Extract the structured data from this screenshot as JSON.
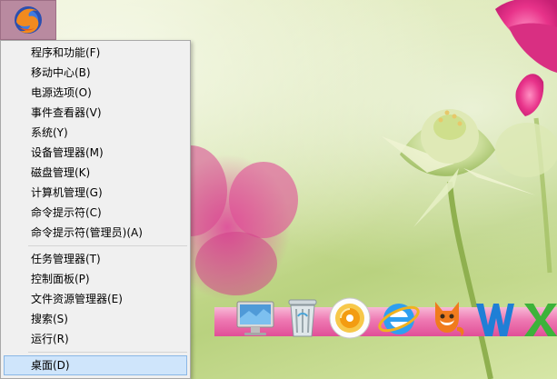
{
  "menu": {
    "groups": [
      {
        "items": [
          {
            "label": "程序和功能(F)"
          },
          {
            "label": "移动中心(B)"
          },
          {
            "label": "电源选项(O)"
          },
          {
            "label": "事件查看器(V)"
          },
          {
            "label": "系统(Y)"
          },
          {
            "label": "设备管理器(M)"
          },
          {
            "label": "磁盘管理(K)"
          },
          {
            "label": "计算机管理(G)"
          },
          {
            "label": "命令提示符(C)"
          },
          {
            "label": "命令提示符(管理员)(A)"
          }
        ]
      },
      {
        "items": [
          {
            "label": "任务管理器(T)"
          },
          {
            "label": "控制面板(P)"
          },
          {
            "label": "文件资源管理器(E)"
          },
          {
            "label": "搜索(S)"
          },
          {
            "label": "运行(R)"
          }
        ]
      },
      {
        "items": [
          {
            "label": "桌面(D)",
            "selected": true
          }
        ]
      }
    ]
  },
  "dock": {
    "icons": [
      "imac-icon",
      "recycle-bin-icon",
      "media-disc-icon",
      "internet-explorer-icon",
      "fox-icon",
      "word-icon",
      "excel-icon"
    ]
  },
  "colors": {
    "menu_bg": "#f0f0f0",
    "selection": "#cfe5fb",
    "dock_pink": "#ee78b2",
    "flower_pink": "#e83f8f"
  }
}
